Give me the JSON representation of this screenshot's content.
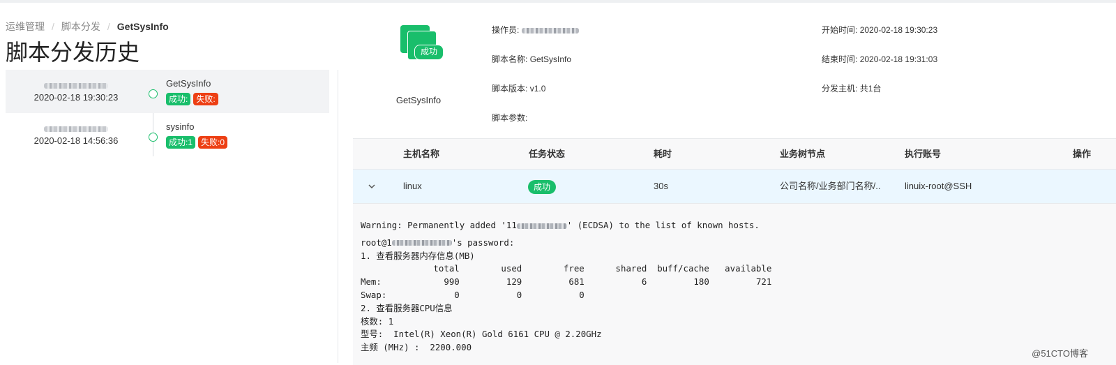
{
  "breadcrumb": {
    "item1": "运维管理",
    "item2": "脚本分发",
    "current": "GetSysInfo"
  },
  "page_title": "脚本分发历史",
  "history": [
    {
      "time": "2020-02-18 19:30:23",
      "script": "GetSysInfo",
      "success_label": "成功:",
      "fail_label": "失败:"
    },
    {
      "time": "2020-02-18 14:56:36",
      "script": "sysinfo",
      "success_label": "成功:1",
      "fail_label": "失败:0"
    }
  ],
  "script": {
    "icon_badge": "成功",
    "name_label": "GetSysInfo"
  },
  "meta": {
    "operator_key": "操作员:",
    "script_name_key": "脚本名称:",
    "script_name": "GetSysInfo",
    "script_version_key": "脚本版本:",
    "script_version": "v1.0",
    "script_params_key": "脚本参数:",
    "start_time_key": "开始时间:",
    "start_time": "2020-02-18 19:30:23",
    "end_time_key": "结束时间:",
    "end_time": "2020-02-18 19:31:03",
    "hosts_key": "分发主机:",
    "hosts": "共1台"
  },
  "table": {
    "headers": [
      "主机名称",
      "任务状态",
      "耗时",
      "业务树节点",
      "执行账号",
      "操作"
    ],
    "row": {
      "host": "linux",
      "status": "成功",
      "duration": "30s",
      "node": "公司名称/业务部门名称/..",
      "account": "linuix-root@SSH"
    }
  },
  "console": {
    "line1_pre": "Warning: Permanently added '11",
    "line1_post": "' (ECDSA) to the list of known hosts.",
    "line2_pre": "root@1",
    "line2_post": "'s password:",
    "body": "1. 查看服务器内存信息(MB)\n              total        used        free      shared  buff/cache   available\nMem:            990         129         681           6         180         721\nSwap:             0           0           0\n2. 查看服务器CPU信息\n核数: 1\n型号:  Intel(R) Xeon(R) Gold 6161 CPU @ 2.20GHz\n主频 (MHz) :  2200.000"
  },
  "watermark": "@51CTO博客",
  "colors": {
    "success": "#19be6b",
    "error": "#ed3f14",
    "row_highlight": "#ebf7ff"
  }
}
